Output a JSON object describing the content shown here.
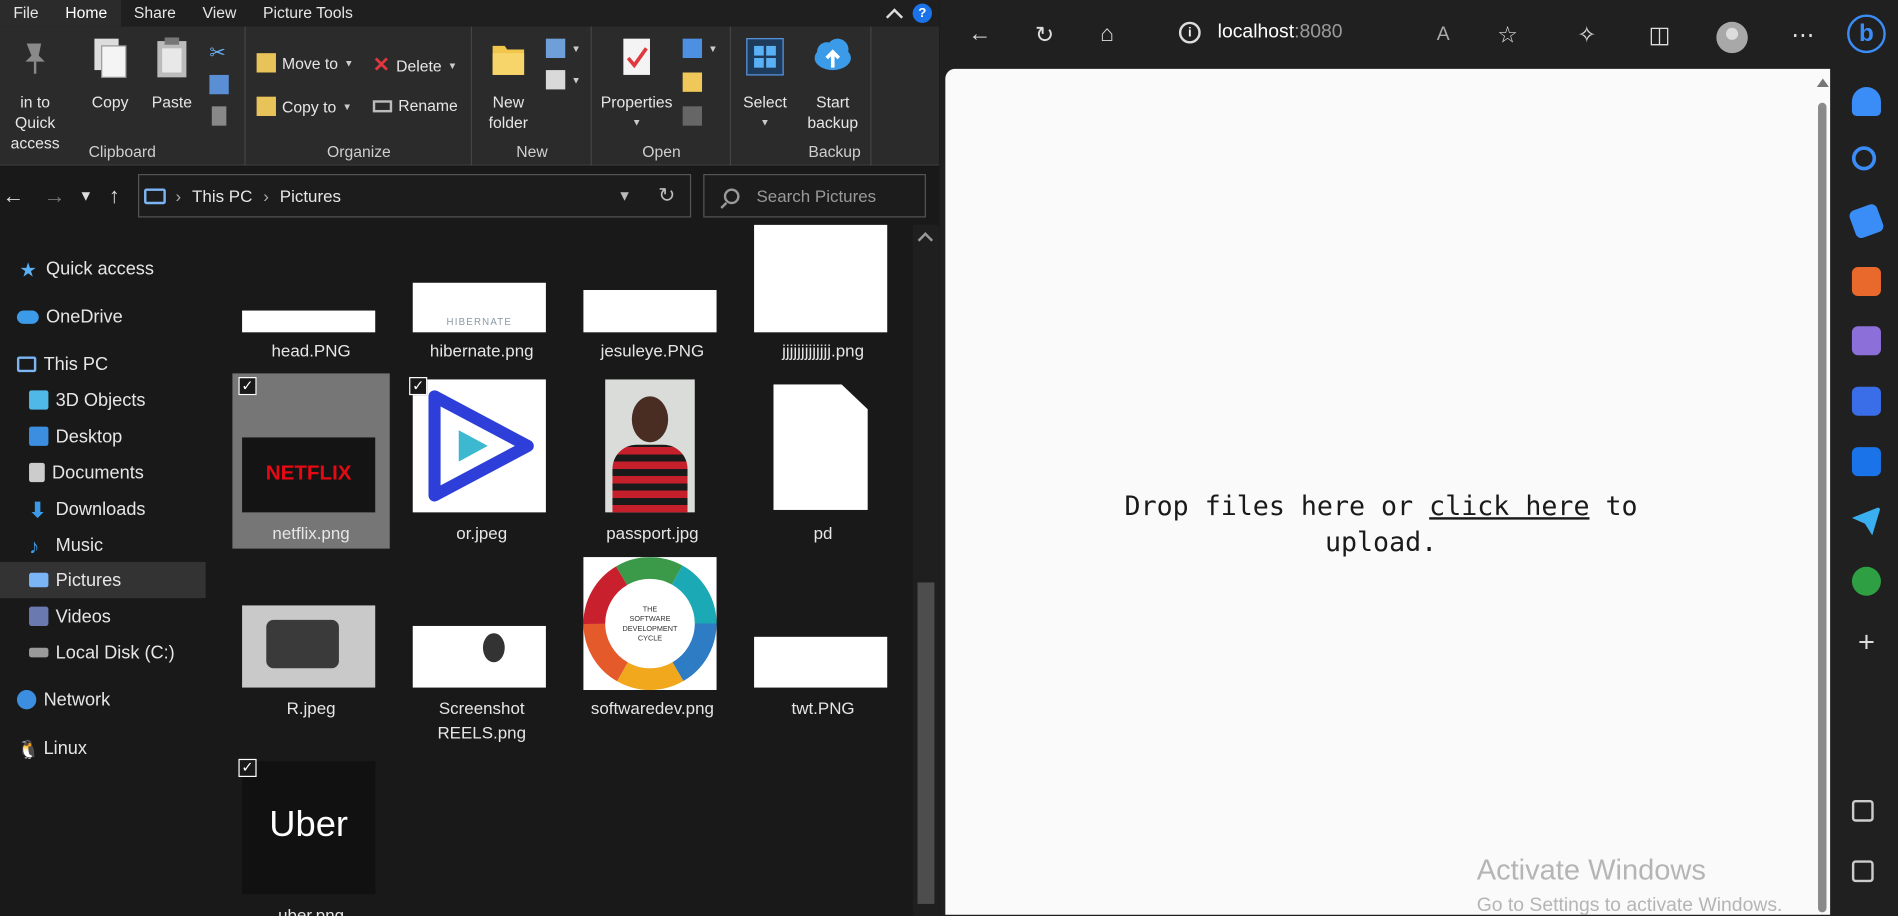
{
  "explorer": {
    "tabs": [
      "File",
      "Home",
      "Share",
      "View",
      "Picture Tools"
    ],
    "active_tab": "Home",
    "clipboard": {
      "pin_label": "in to Quick access",
      "copy_label": "Copy",
      "paste_label": "Paste",
      "group_label": "Clipboard"
    },
    "organize": {
      "move_to": "Move to",
      "copy_to": "Copy to",
      "delete": "Delete",
      "rename": "Rename",
      "group_label": "Organize"
    },
    "new": {
      "new_folder": "New folder",
      "group_label": "New"
    },
    "open": {
      "properties": "Properties",
      "group_label": "Open"
    },
    "select": {
      "label": "Select"
    },
    "backup": {
      "start_backup": "Start backup",
      "group_label": "Backup"
    },
    "address": {
      "crumbs": [
        "This PC",
        "Pictures"
      ]
    },
    "search": {
      "placeholder": "Search Pictures"
    },
    "nav": [
      {
        "label": "Quick access",
        "icon": "star-icon"
      },
      {
        "label": "OneDrive",
        "icon": "cloud-icon"
      },
      {
        "label": "This PC",
        "icon": "pc-icon"
      },
      {
        "label": "3D Objects",
        "icon": "cube-icon"
      },
      {
        "label": "Desktop",
        "icon": "desktop-icon"
      },
      {
        "label": "Documents",
        "icon": "document-icon"
      },
      {
        "label": "Downloads",
        "icon": "download-icon"
      },
      {
        "label": "Music",
        "icon": "music-icon"
      },
      {
        "label": "Pictures",
        "icon": "pictures-icon",
        "selected": true
      },
      {
        "label": "Videos",
        "icon": "video-icon"
      },
      {
        "label": "Local Disk (C:)",
        "icon": "drive-icon"
      },
      {
        "label": "Network",
        "icon": "network-icon"
      },
      {
        "label": "Linux",
        "icon": "linux-icon"
      }
    ],
    "files": [
      {
        "name": "head.PNG"
      },
      {
        "name": "hibernate.png",
        "thumb_text": "HIBERNATE"
      },
      {
        "name": "jesuleye.PNG"
      },
      {
        "name": "jjjjjjjjjjjjj.png"
      },
      {
        "name": "netflix.png",
        "selected": true,
        "checked": true,
        "thumb_text": "NETFLIX"
      },
      {
        "name": "or.jpeg",
        "checked": true
      },
      {
        "name": "passport.jpg"
      },
      {
        "name": "pd"
      },
      {
        "name": "R.jpeg"
      },
      {
        "name": "Screenshot REELS.png"
      },
      {
        "name": "softwaredev.png",
        "thumb_text": "THE SOFTWARE DEVELOPMENT CYCLE"
      },
      {
        "name": "twt.PNG"
      },
      {
        "name": "uber.png",
        "checked": true,
        "thumb_text": "Uber"
      }
    ]
  },
  "browser": {
    "url_host": "localhost",
    "url_port": ":8080",
    "drop_text_before": "Drop files here or ",
    "drop_link": "click here",
    "drop_text_after": " to upload.",
    "watermark_title": "Activate Windows",
    "watermark_sub": "Go to Settings to activate Windows."
  },
  "colors": {
    "explorer_bg": "#191919",
    "ribbon_bg": "#2b2b2b",
    "accent_blue": "#1a73e8",
    "page_bg": "#fafafa"
  }
}
